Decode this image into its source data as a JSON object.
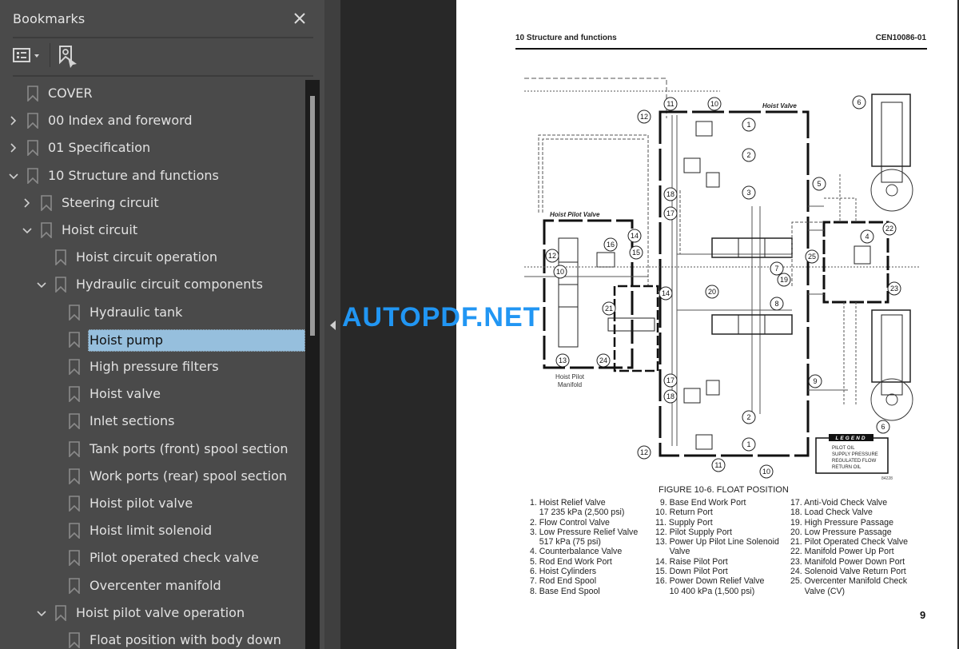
{
  "panel": {
    "title": "Bookmarks",
    "close_icon": "close-icon",
    "options_icon": "bookmark-options-icon",
    "find_icon": "find-current-bookmark-icon"
  },
  "bookmarks": [
    {
      "label": "COVER",
      "level": 0,
      "expander": "none",
      "selected": false
    },
    {
      "label": "00 Index and foreword",
      "level": 0,
      "expander": "collapsed",
      "selected": false
    },
    {
      "label": "01 Specification",
      "level": 0,
      "expander": "collapsed",
      "selected": false
    },
    {
      "label": "10 Structure and functions",
      "level": 0,
      "expander": "expanded",
      "selected": false
    },
    {
      "label": "Steering circuit",
      "level": 1,
      "expander": "collapsed",
      "selected": false
    },
    {
      "label": "Hoist circuit",
      "level": 1,
      "expander": "expanded",
      "selected": false
    },
    {
      "label": "Hoist circuit operation",
      "level": 2,
      "expander": "none",
      "selected": false
    },
    {
      "label": "Hydraulic circuit components",
      "level": 2,
      "expander": "expanded",
      "selected": false
    },
    {
      "label": "Hydraulic tank",
      "level": 3,
      "expander": "none",
      "selected": false
    },
    {
      "label": "Hoist pump",
      "level": 3,
      "expander": "none",
      "selected": true
    },
    {
      "label": "High pressure filters",
      "level": 3,
      "expander": "none",
      "selected": false
    },
    {
      "label": "Hoist valve",
      "level": 3,
      "expander": "none",
      "selected": false
    },
    {
      "label": "Inlet sections",
      "level": 3,
      "expander": "none",
      "selected": false
    },
    {
      "label": "Tank ports (front) spool section",
      "level": 3,
      "expander": "none",
      "selected": false
    },
    {
      "label": "Work ports (rear) spool section",
      "level": 3,
      "expander": "none",
      "selected": false
    },
    {
      "label": "Hoist pilot valve",
      "level": 3,
      "expander": "none",
      "selected": false
    },
    {
      "label": "Hoist limit solenoid",
      "level": 3,
      "expander": "none",
      "selected": false
    },
    {
      "label": "Pilot operated check valve",
      "level": 3,
      "expander": "none",
      "selected": false
    },
    {
      "label": "Overcenter manifold",
      "level": 3,
      "expander": "none",
      "selected": false
    },
    {
      "label": "Hoist pilot valve operation",
      "level": 2,
      "expander": "expanded",
      "selected": false
    },
    {
      "label": "Float position with body down",
      "level": 3,
      "expander": "none",
      "selected": false
    }
  ],
  "watermark": "AUTOPDF.NET",
  "document": {
    "header_left": "10 Structure and functions",
    "header_right": "CEN10086-01",
    "page_number": "9",
    "figure_caption": "FIGURE 10-6. FLOAT POSITION",
    "diagram_labels": {
      "hoist_valve": "Hoist Valve",
      "hoist_pilot_valve": "Hoist Pilot Valve",
      "hoist_pilot_manifold_line1": "Hoist Pilot",
      "hoist_pilot_manifold_line2": "Manifold",
      "legend_title": "LEGEND",
      "legend_items": [
        "PILOT OIL",
        "SUPPLY PRESSURE",
        "REGULATED FLOW",
        "RETURN OIL"
      ],
      "figure_code": "84228"
    },
    "legend_columns": [
      [
        "1. Hoist Relief Valve",
        "    17 235 kPa (2,500 psi)",
        "2. Flow Control Valve",
        "3. Low Pressure Relief Valve",
        "    517 kPa (75 psi)",
        "4. Counterbalance Valve",
        "5. Rod End Work Port",
        "6. Hoist Cylinders",
        "7. Rod End Spool",
        "8. Base End Spool"
      ],
      [
        "  9. Base End Work Port",
        "10. Return Port",
        "11. Supply Port",
        "12. Pilot Supply Port",
        "13. Power Up Pilot Line Solenoid",
        "      Valve",
        "14. Raise Pilot Port",
        "15. Down Pilot Port",
        "16. Power Down Relief Valve",
        "      10 400 kPa (1,500 psi)"
      ],
      [
        "17. Anti-Void Check Valve",
        "18. Load Check Valve",
        "19. High Pressure Passage",
        "20. Low Pressure Passage",
        "21. Pilot Operated Check Valve",
        "22. Manifold Power Up Port",
        "23. Manifold Power Down Port",
        "24. Solenoid Valve Return Port",
        "25. Overcenter Manifold Check",
        "      Valve (CV)"
      ]
    ]
  }
}
